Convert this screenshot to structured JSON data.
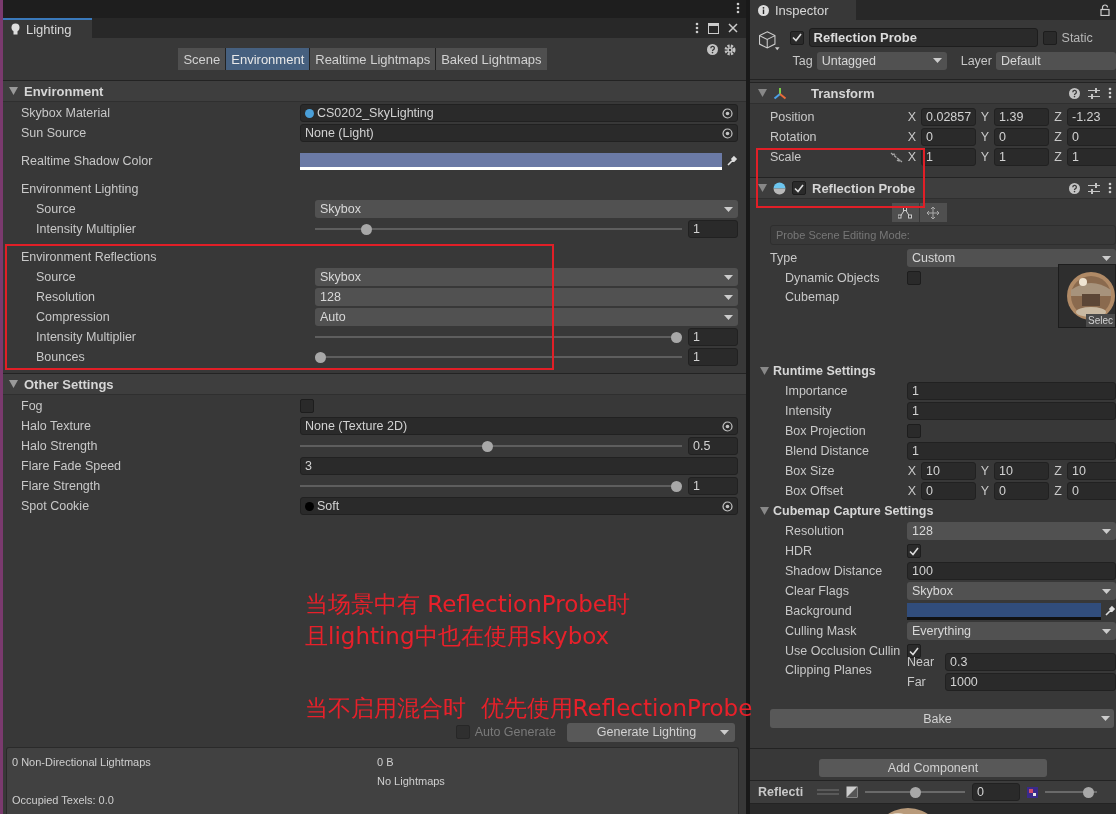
{
  "lighting": {
    "title": "Lighting",
    "tabs": [
      {
        "label": "Scene",
        "selected": false
      },
      {
        "label": "Environment",
        "selected": true
      },
      {
        "label": "Realtime Lightmaps",
        "selected": false
      },
      {
        "label": "Baked Lightmaps",
        "selected": false
      }
    ],
    "sections": [
      {
        "title": "Environment",
        "expanded": true,
        "rows": [
          {
            "kind": "object",
            "label": "Skybox Material",
            "value": "CS0202_SkyLighting",
            "color": "#4a9fd8"
          },
          {
            "kind": "object",
            "label": "Sun Source",
            "value": "None (Light)"
          },
          {
            "kind": "color",
            "label": "Realtime Shadow Color",
            "color": "#6b7aa6"
          },
          {
            "kind": "group",
            "label": "Environment Lighting",
            "children": [
              {
                "kind": "dropdown",
                "label": "Source",
                "value": "Skybox"
              },
              {
                "kind": "slider",
                "label": "Intensity Multiplier",
                "level": 0.13,
                "value": "1"
              }
            ]
          },
          {
            "kind": "group",
            "label": "Environment Reflections",
            "children": [
              {
                "kind": "dropdown",
                "label": "Source",
                "value": "Skybox"
              },
              {
                "kind": "dropdown",
                "label": "Resolution",
                "value": "128"
              },
              {
                "kind": "dropdown",
                "label": "Compression",
                "value": "Auto"
              },
              {
                "kind": "slider",
                "label": "Intensity Multiplier",
                "level": 1,
                "value": "1"
              },
              {
                "kind": "slider",
                "label": "Bounces",
                "level": 0,
                "value": "1"
              }
            ]
          }
        ]
      },
      {
        "title": "Other Settings",
        "expanded": true,
        "rows": [
          {
            "kind": "checkbox",
            "label": "Fog",
            "checked": false
          },
          {
            "kind": "object",
            "label": "Halo Texture",
            "value": "None (Texture 2D)"
          },
          {
            "kind": "slider",
            "label": "Halo Strength",
            "level": 0.49,
            "value": "0.5"
          },
          {
            "kind": "field",
            "label": "Flare Fade Speed",
            "value": "3"
          },
          {
            "kind": "slider",
            "label": "Flare Strength",
            "level": 1,
            "value": "1"
          },
          {
            "kind": "object",
            "label": "Spot Cookie",
            "value": "Soft",
            "color": "#000000"
          }
        ]
      }
    ],
    "auto_generate": {
      "label": "Auto Generate",
      "checked": false
    },
    "generate_button": "Generate Lighting",
    "stats": {
      "lightmaps": "0 Non-Directional Lightmaps",
      "size": "0 B",
      "status": "No Lightmaps",
      "texels": "Occupied Texels: 0.0"
    }
  },
  "inspector": {
    "title": "Inspector",
    "object": {
      "active": true,
      "name": "Reflection Probe",
      "static": {
        "label": "Static",
        "checked": false
      },
      "tag": {
        "label": "Tag",
        "value": "Untagged"
      },
      "layer": {
        "label": "Layer",
        "value": "Default"
      }
    },
    "components": [
      {
        "title": "Transform",
        "expanded": true,
        "rows": [
          {
            "kind": "vector",
            "label": "Position",
            "axes": [
              {
                "axis": "X",
                "value": "0.02857"
              },
              {
                "axis": "Y",
                "value": "1.39"
              },
              {
                "axis": "Z",
                "value": "-1.23"
              }
            ]
          },
          {
            "kind": "vector",
            "label": "Rotation",
            "axes": [
              {
                "axis": "X",
                "value": "0"
              },
              {
                "axis": "Y",
                "value": "0"
              },
              {
                "axis": "Z",
                "value": "0"
              }
            ]
          },
          {
            "kind": "vector",
            "label": "Scale",
            "linked": false,
            "axes": [
              {
                "axis": "X",
                "value": "1"
              },
              {
                "axis": "Y",
                "value": "1"
              },
              {
                "axis": "Z",
                "value": "1"
              }
            ]
          }
        ]
      },
      {
        "title": "Reflection Probe",
        "enabled": true,
        "expanded": true,
        "mode_label": "Probe Scene Editing Mode:",
        "rows": [
          {
            "kind": "dropdown",
            "label": "Type",
            "value": "Custom",
            "children": [
              {
                "kind": "checkbox",
                "label": "Dynamic Objects",
                "checked": false
              },
              {
                "kind": "cubemap",
                "label": "Cubemap",
                "button": "Selec"
              }
            ]
          },
          {
            "kind": "foldout",
            "label": "Runtime Settings",
            "expanded": true,
            "children": [
              {
                "kind": "field",
                "label": "Importance",
                "value": "1"
              },
              {
                "kind": "field",
                "label": "Intensity",
                "value": "1"
              },
              {
                "kind": "checkbox",
                "label": "Box Projection",
                "checked": false
              },
              {
                "kind": "field",
                "label": "Blend Distance",
                "value": "1"
              },
              {
                "kind": "vector",
                "label": "Box Size",
                "axes": [
                  {
                    "axis": "X",
                    "value": "10"
                  },
                  {
                    "axis": "Y",
                    "value": "10"
                  },
                  {
                    "axis": "Z",
                    "value": "10"
                  }
                ]
              },
              {
                "kind": "vector",
                "label": "Box Offset",
                "axes": [
                  {
                    "axis": "X",
                    "value": "0"
                  },
                  {
                    "axis": "Y",
                    "value": "0"
                  },
                  {
                    "axis": "Z",
                    "value": "0"
                  }
                ]
              }
            ]
          },
          {
            "kind": "foldout",
            "label": "Cubemap Capture Settings",
            "expanded": true,
            "children": [
              {
                "kind": "dropdown",
                "label": "Resolution",
                "value": "128"
              },
              {
                "kind": "checkbox",
                "label": "HDR",
                "checked": true
              },
              {
                "kind": "field",
                "label": "Shadow Distance",
                "value": "100"
              },
              {
                "kind": "dropdown",
                "label": "Clear Flags",
                "value": "Skybox"
              },
              {
                "kind": "color",
                "label": "Background",
                "color": "#314d7c"
              },
              {
                "kind": "dropdown",
                "label": "Culling Mask",
                "value": "Everything"
              },
              {
                "kind": "checkbox",
                "label": "Use Occlusion Cullin",
                "checked": true
              },
              {
                "kind": "planes",
                "label": "Clipping Planes",
                "axes": [
                  {
                    "axis": "Near",
                    "value": "0.3"
                  },
                  {
                    "axis": "Far",
                    "value": "1000"
                  }
                ]
              }
            ]
          }
        ],
        "bake_button": "Bake"
      }
    ],
    "add_component": "Add Component",
    "preview": {
      "label": "Reflecti",
      "value": "0",
      "sliders": [
        {
          "level": 0.5
        },
        {
          "level": 0.93
        }
      ]
    }
  },
  "annotations": {
    "lines": [
      "当场景中有 ReflectionProbe时",
      "且lighting中也在使用skybox",
      "当不启用混合时  优先使用ReflectionProbe"
    ]
  }
}
